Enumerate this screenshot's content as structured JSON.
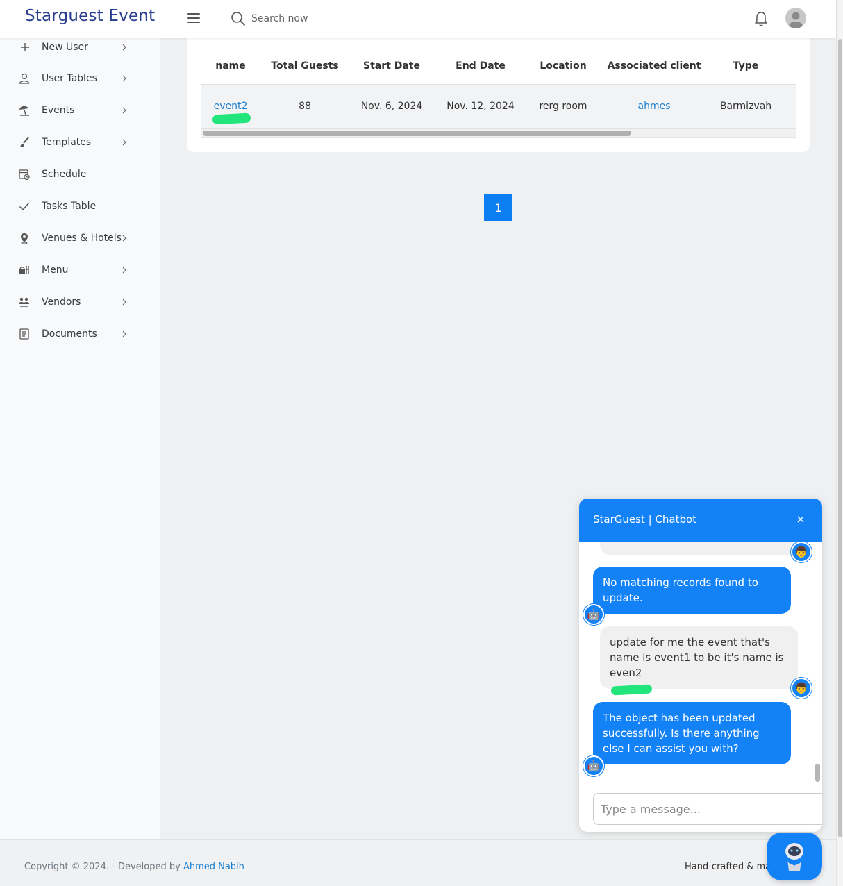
{
  "header": {
    "brand": "Starguest Event",
    "search_placeholder": "Search now"
  },
  "sidebar": {
    "items": [
      {
        "label": "New User",
        "icon": "plus-icon",
        "has_chevron": true
      },
      {
        "label": "User Tables",
        "icon": "user-icon",
        "has_chevron": true
      },
      {
        "label": "Events",
        "icon": "beach-umbrella-icon",
        "has_chevron": true
      },
      {
        "label": "Templates",
        "icon": "brush-icon",
        "has_chevron": true
      },
      {
        "label": "Schedule",
        "icon": "calendar-clock-icon",
        "has_chevron": false
      },
      {
        "label": "Tasks Table",
        "icon": "check-icon",
        "has_chevron": false
      },
      {
        "label": "Venues & Hotels",
        "icon": "map-pin-icon",
        "has_chevron": true
      },
      {
        "label": "Menu",
        "icon": "food-icon",
        "has_chevron": true
      },
      {
        "label": "Vendors",
        "icon": "people-icon",
        "has_chevron": true
      },
      {
        "label": "Documents",
        "icon": "document-icon",
        "has_chevron": true
      }
    ]
  },
  "table": {
    "columns": [
      "name",
      "Total Guests",
      "Start Date",
      "End Date",
      "Location",
      "Associated client",
      "Type"
    ],
    "rows": [
      {
        "name": "event2",
        "total_guests": "88",
        "start_date": "Nov. 6, 2024",
        "end_date": "Nov. 12, 2024",
        "location": "rerg room",
        "client": "ahmes",
        "type": "Barmizvah"
      }
    ]
  },
  "pagination": {
    "current": "1"
  },
  "footer": {
    "copyright": "Copyright © 2024. - Developed by ",
    "developer": "Ahmed Nabih",
    "right_text": "Hand-crafted & mad"
  },
  "chat": {
    "title": "StarGuest | Chatbot",
    "close_label": "×",
    "messages": [
      {
        "sender": "bot",
        "text": "No matching records found to update."
      },
      {
        "sender": "user",
        "text": "update for me the event that's name is event1 to be it's name is even2"
      },
      {
        "sender": "bot",
        "text": "The object has been updated successfully. Is there anything else I can assist you with?"
      }
    ],
    "input_placeholder": "Type a message..."
  },
  "colors": {
    "brand": "#283f8f",
    "primary": "#1482f7",
    "link": "#1a7fd0",
    "highlight": "#22e57c"
  }
}
